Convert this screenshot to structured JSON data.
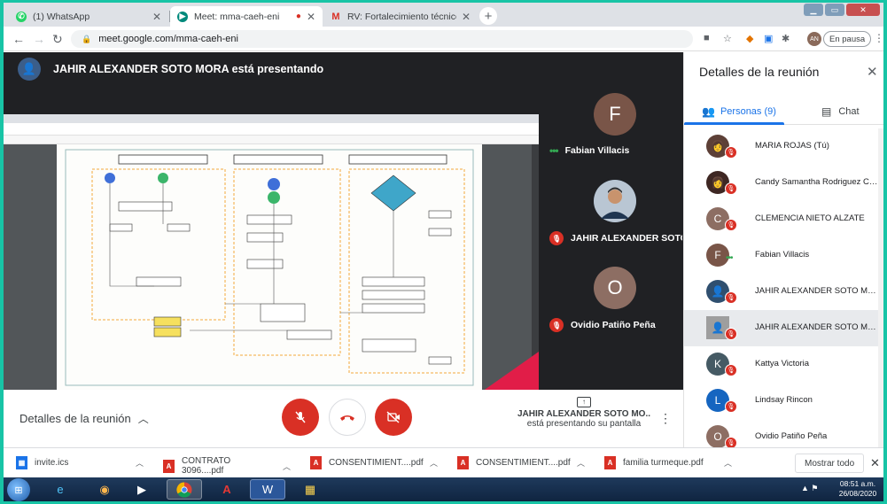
{
  "browser": {
    "tabs": [
      {
        "title": "(1) WhatsApp",
        "icon": "whatsapp-icon",
        "color": "#25d366"
      },
      {
        "title": "Meet: mma-caeh-eni",
        "icon": "meet-icon",
        "color": "#00897b",
        "recording": true
      },
      {
        "title": "RV: Fortalecimiento técnico a pr...",
        "icon": "gmail-icon",
        "color": "#d93025"
      }
    ],
    "url": "meet.google.com/mma-caeh-eni",
    "profile_initials": "AN",
    "pause_label": "En pausa"
  },
  "meet": {
    "presenter_header": "JAHIR ALEXANDER SOTO MORA está presentando",
    "tiles": [
      {
        "initial": "F",
        "name": "Fabian Villacis",
        "color": "#795548",
        "status": "speaking"
      },
      {
        "initial": "",
        "name": "JAHIR ALEXANDER SOTO ...",
        "color": "#2f4f6f",
        "status": "muted"
      },
      {
        "initial": "O",
        "name": "Ovidio Patiño Peña",
        "color": "#8d6e63",
        "status": "muted"
      }
    ],
    "controls": {
      "details_label": "Detalles de la reunión",
      "presenting_name": "JAHIR ALEXANDER SOTO MO...",
      "presenting_text": "está presentando su pantalla"
    }
  },
  "panel": {
    "title": "Detalles de la reunión",
    "tab_people": "Personas (9)",
    "tab_chat": "Chat",
    "participants": [
      {
        "name": "MARIA ROJAS (Tú)",
        "initial": "",
        "color": "#5d4037",
        "status": "muted"
      },
      {
        "name": "Candy Samantha Rodriguez Ca...",
        "initial": "",
        "color": "#3e2723",
        "status": "muted"
      },
      {
        "name": "CLEMENCIA NIETO ALZATE",
        "initial": "C",
        "color": "#8d6e63",
        "status": "muted"
      },
      {
        "name": "Fabian Villacis",
        "initial": "F",
        "color": "#795548",
        "status": "speaking"
      },
      {
        "name": "JAHIR ALEXANDER SOTO MO...",
        "initial": "",
        "color": "#2f4f6f",
        "status": "muted"
      },
      {
        "name": "JAHIR ALEXANDER SOTO MO...",
        "initial": "",
        "color": "#9e9e9e",
        "status": "muted"
      },
      {
        "name": "Kattya Victoria",
        "initial": "K",
        "color": "#455a64",
        "status": "muted"
      },
      {
        "name": "Lindsay Rincon",
        "initial": "L",
        "color": "#1565c0",
        "status": "muted"
      },
      {
        "name": "Ovidio Patiño Peña",
        "initial": "O",
        "color": "#8d6e63",
        "status": "muted"
      }
    ]
  },
  "downloads": {
    "items": [
      {
        "name": "invite.ics",
        "type": "ics"
      },
      {
        "name": "CONTRATO 3096....pdf",
        "type": "pdf"
      },
      {
        "name": "CONSENTIMIENT....pdf",
        "type": "pdf"
      },
      {
        "name": "CONSENTIMIENT....pdf",
        "type": "pdf"
      },
      {
        "name": "familia turmeque.pdf",
        "type": "pdf"
      }
    ],
    "show_all": "Mostrar todo"
  },
  "taskbar": {
    "time": "08:51 a.m.",
    "date": "26/08/2020"
  },
  "colors": {
    "meet_bg": "#202124",
    "accent_blue": "#1a73e8",
    "danger_red": "#d93025",
    "speaking_green": "#34a853"
  }
}
